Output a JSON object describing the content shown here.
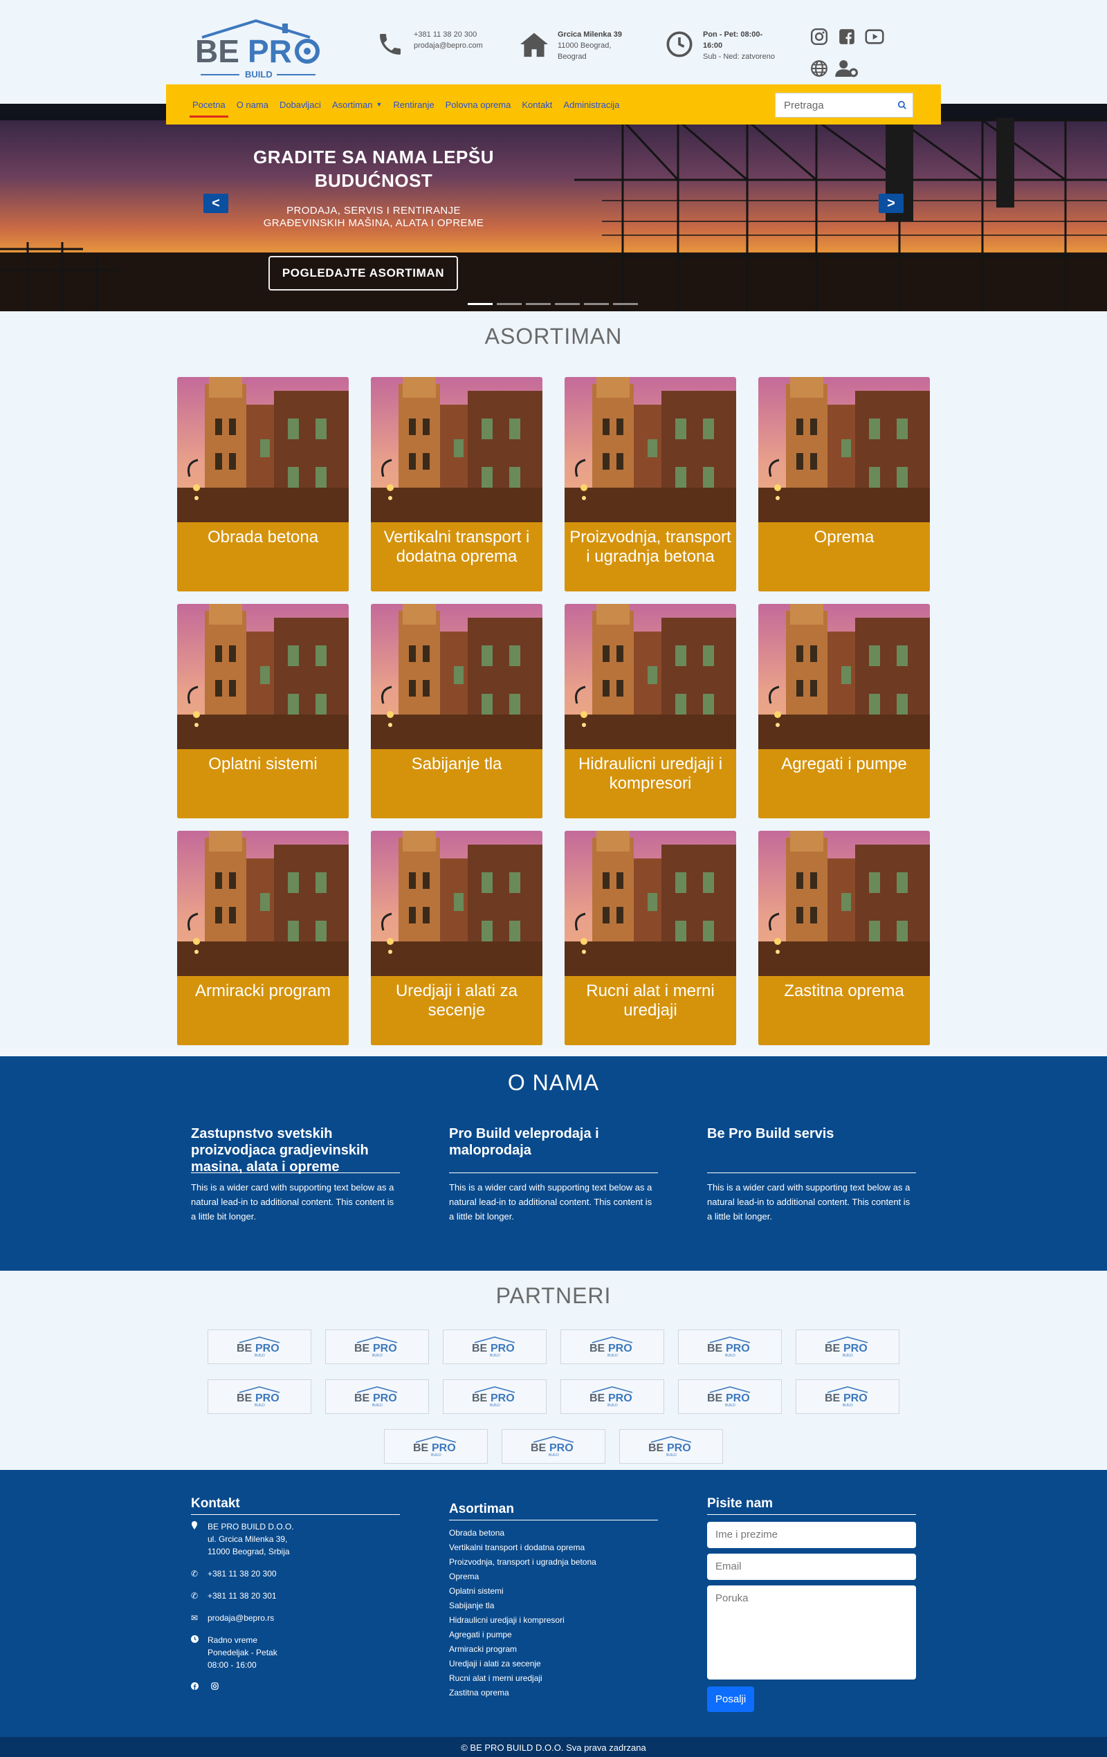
{
  "brand": {
    "name_top": "BE PRO",
    "name_sub": "BUILD"
  },
  "contact_header": {
    "phone": {
      "line1": "+381 11 38 20 300",
      "line2": "prodaja@bepro.com"
    },
    "address": {
      "line1": "Grcica Milenka 39",
      "line2": "11000 Beograd,",
      "line3": "Beograd"
    },
    "hours": {
      "line1": "Pon - Pet: 08:00-",
      "line2": "16:00",
      "line3": "Sub - Ned: zatvoreno"
    }
  },
  "nav": {
    "items": [
      "Pocetna",
      "O nama",
      "Dobavljaci",
      "Asortiman",
      "Rentiranje",
      "Polovna oprema",
      "Kontakt",
      "Administracija"
    ],
    "active": "Pocetna",
    "search_placeholder": "Pretraga"
  },
  "hero": {
    "title": "GRADITE SA NAMA LEPŠU BUDUĆNOST",
    "subtitle": "PRODAJA, SERVIS I RENTIRANJE GRAĐEVINSKIH MAŠINA, ALATA I OPREME",
    "cta": "POGLEDAJTE ASORTIMAN",
    "prev": "<",
    "next": ">"
  },
  "asortiman": {
    "title": "ASORTIMAN",
    "items": [
      "Obrada betona",
      "Vertikalni transport i dodatna oprema",
      "Proizvodnja, transport i ugradnja betona",
      "Oprema",
      "Oplatni sistemi",
      "Sabijanje tla",
      "Hidraulicni uredjaji i kompresori",
      "Agregati i pumpe",
      "Armiracki program",
      "Uredjaji i alati za secenje",
      "Rucni alat i merni uredjaji",
      "Zastitna oprema"
    ]
  },
  "onama": {
    "title": "O NAMA",
    "cols": [
      {
        "title": "Zastupnstvo svetskih proizvodjaca gradjevinskih masina, alata i opreme",
        "text": "This is a wider card with supporting text below as a natural lead-in to additional content. This content is a little bit longer."
      },
      {
        "title": "Pro Build veleprodaja i maloprodaja",
        "text": "This is a wider card with supporting text below as a natural lead-in to additional content. This content is a little bit longer."
      },
      {
        "title": "Be Pro Build servis",
        "text": "This is a wider card with supporting text below as a natural lead-in to additional content. This content is a little bit longer."
      }
    ]
  },
  "partneri": {
    "title": "PARTNERI",
    "count": 15
  },
  "footer": {
    "kontakt": {
      "title": "Kontakt",
      "company": "BE PRO BUILD D.O.O.",
      "street": "ul. Grcica Milenka 39,",
      "city": "11000 Beograd, Srbija",
      "phone1": "+381 11 38 20 300",
      "phone2": "+381 11 38 20 301",
      "email": "prodaja@bepro.rs",
      "hours_label": "Radno vreme",
      "hours_days": "Ponedeljak - Petak",
      "hours_time": "08:00 - 16:00"
    },
    "asortiman": {
      "title": "Asortiman",
      "items": [
        "Obrada betona",
        "Vertikalni transport i dodatna oprema",
        "Proizvodnja, transport i ugradnja betona",
        "Oprema",
        "Oplatni sistemi",
        "Sabijanje tla",
        "Hidraulicni uredjaji i kompresori",
        "Agregati i pumpe",
        "Armiracki program",
        "Uredjaji i alati za secenje",
        "Rucni alat i merni uredjaji",
        "Zastitna oprema"
      ]
    },
    "form": {
      "title": "Pisite nam",
      "name_placeholder": "Ime i prezime",
      "email_placeholder": "Email",
      "message_placeholder": "Poruka",
      "submit": "Posalji"
    },
    "copyright": "© BE PRO BUILD D.O.O. Sva prava zadrzana"
  },
  "colors": {
    "nav_bg": "#fcc201",
    "primary_blue": "#094a8c",
    "card_label": "#e6a00a",
    "active_underline": "#e0281e"
  }
}
